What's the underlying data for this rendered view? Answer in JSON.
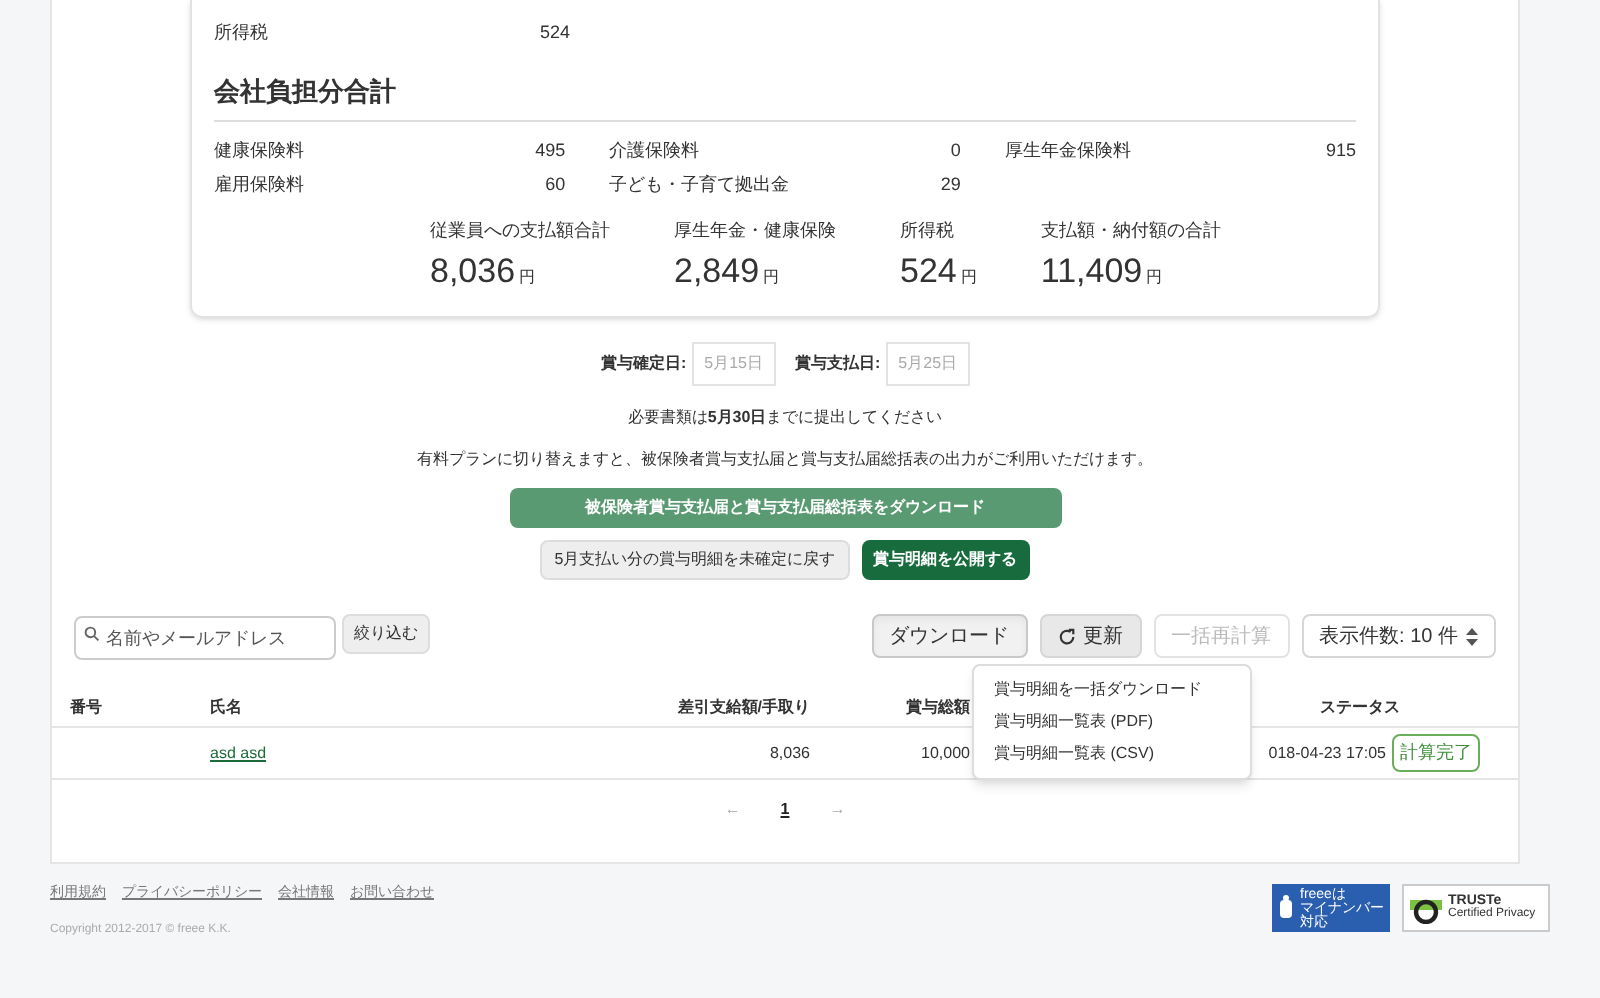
{
  "employee_rows": [
    {
      "label": "所得税",
      "value": "524"
    }
  ],
  "company": {
    "heading": "会社負担分合計",
    "items": [
      {
        "label": "健康保険料",
        "value": "495"
      },
      {
        "label": "介護保険料",
        "value": "0"
      },
      {
        "label": "厚生年金保険料",
        "value": "915"
      },
      {
        "label": "雇用保険料",
        "value": "60"
      },
      {
        "label": "子ども・子育て拠出金",
        "value": "29"
      }
    ]
  },
  "totals": [
    {
      "label": "従業員への支払額合計",
      "value": "8,036",
      "unit": "円"
    },
    {
      "label": "厚生年金・健康保険",
      "value": "2,849",
      "unit": "円"
    },
    {
      "label": "所得税",
      "value": "524",
      "unit": "円"
    },
    {
      "label": "支払額・納付額の合計",
      "value": "11,409",
      "unit": "円"
    }
  ],
  "dates": [
    {
      "label": "賞与確定日:",
      "value": "5月15日"
    },
    {
      "label": "賞与支払日:",
      "value": "5月25日"
    }
  ],
  "notice": "必要書類は**5月30日**までに提出してください",
  "plan_note": "有料プランに切り替えますと、被保険者賞与支払届と賞与支払届総括表の出力がご利用いただけます。",
  "download_forms_button": "被保険者賞与支払届と賞与支払届総括表をダウンロード",
  "revert_button": "5月支払い分の賞与明細を未確定に戻す",
  "publish_button": "賞与明細を公開する",
  "search": {
    "placeholder": "名前やメールアドレス",
    "button": "絞り込む"
  },
  "toolbar": [
    {
      "label": "ダウンロード",
      "kind": "menu",
      "disabled": false,
      "expanded": true
    },
    {
      "label": "更新",
      "kind": "refresh",
      "disabled": false
    },
    {
      "label": "一括再計算",
      "kind": "plain",
      "disabled": true
    },
    {
      "label": "表示件数: 10 件",
      "kind": "select",
      "disabled": false
    }
  ],
  "download_menu": [
    "賞与明細を一括ダウンロード",
    "賞与明細一覧表 (PDF)",
    "賞与明細一覧表 (CSV)"
  ],
  "table": {
    "columns": [
      "番号",
      "氏名",
      "差引支給額/手取り",
      "賞与総額",
      "ステータス"
    ],
    "rows": [
      {
        "name": "asd asd",
        "net": "8,036",
        "gross": "10,000",
        "date": "018-04-23 17:05",
        "status": "計算完了"
      }
    ]
  },
  "pagination": [
    {
      "label": "←",
      "kind": "prev",
      "selected": false
    },
    {
      "label": "1",
      "kind": "page",
      "selected": true
    },
    {
      "label": "→",
      "kind": "next",
      "selected": false
    }
  ],
  "footer_links": [
    "利用規約",
    "プライバシーポリシー",
    "会社情報",
    "お問い合わせ"
  ],
  "copyright": "Copyright 2012-2017 © freee K.K.",
  "badges": [
    {
      "kind": "mynumber",
      "lines": [
        "freeeは",
        "マイナンバー",
        "対応"
      ]
    },
    {
      "kind": "truste",
      "lines": [
        "TRUSTe",
        "Certified Privacy"
      ]
    }
  ]
}
